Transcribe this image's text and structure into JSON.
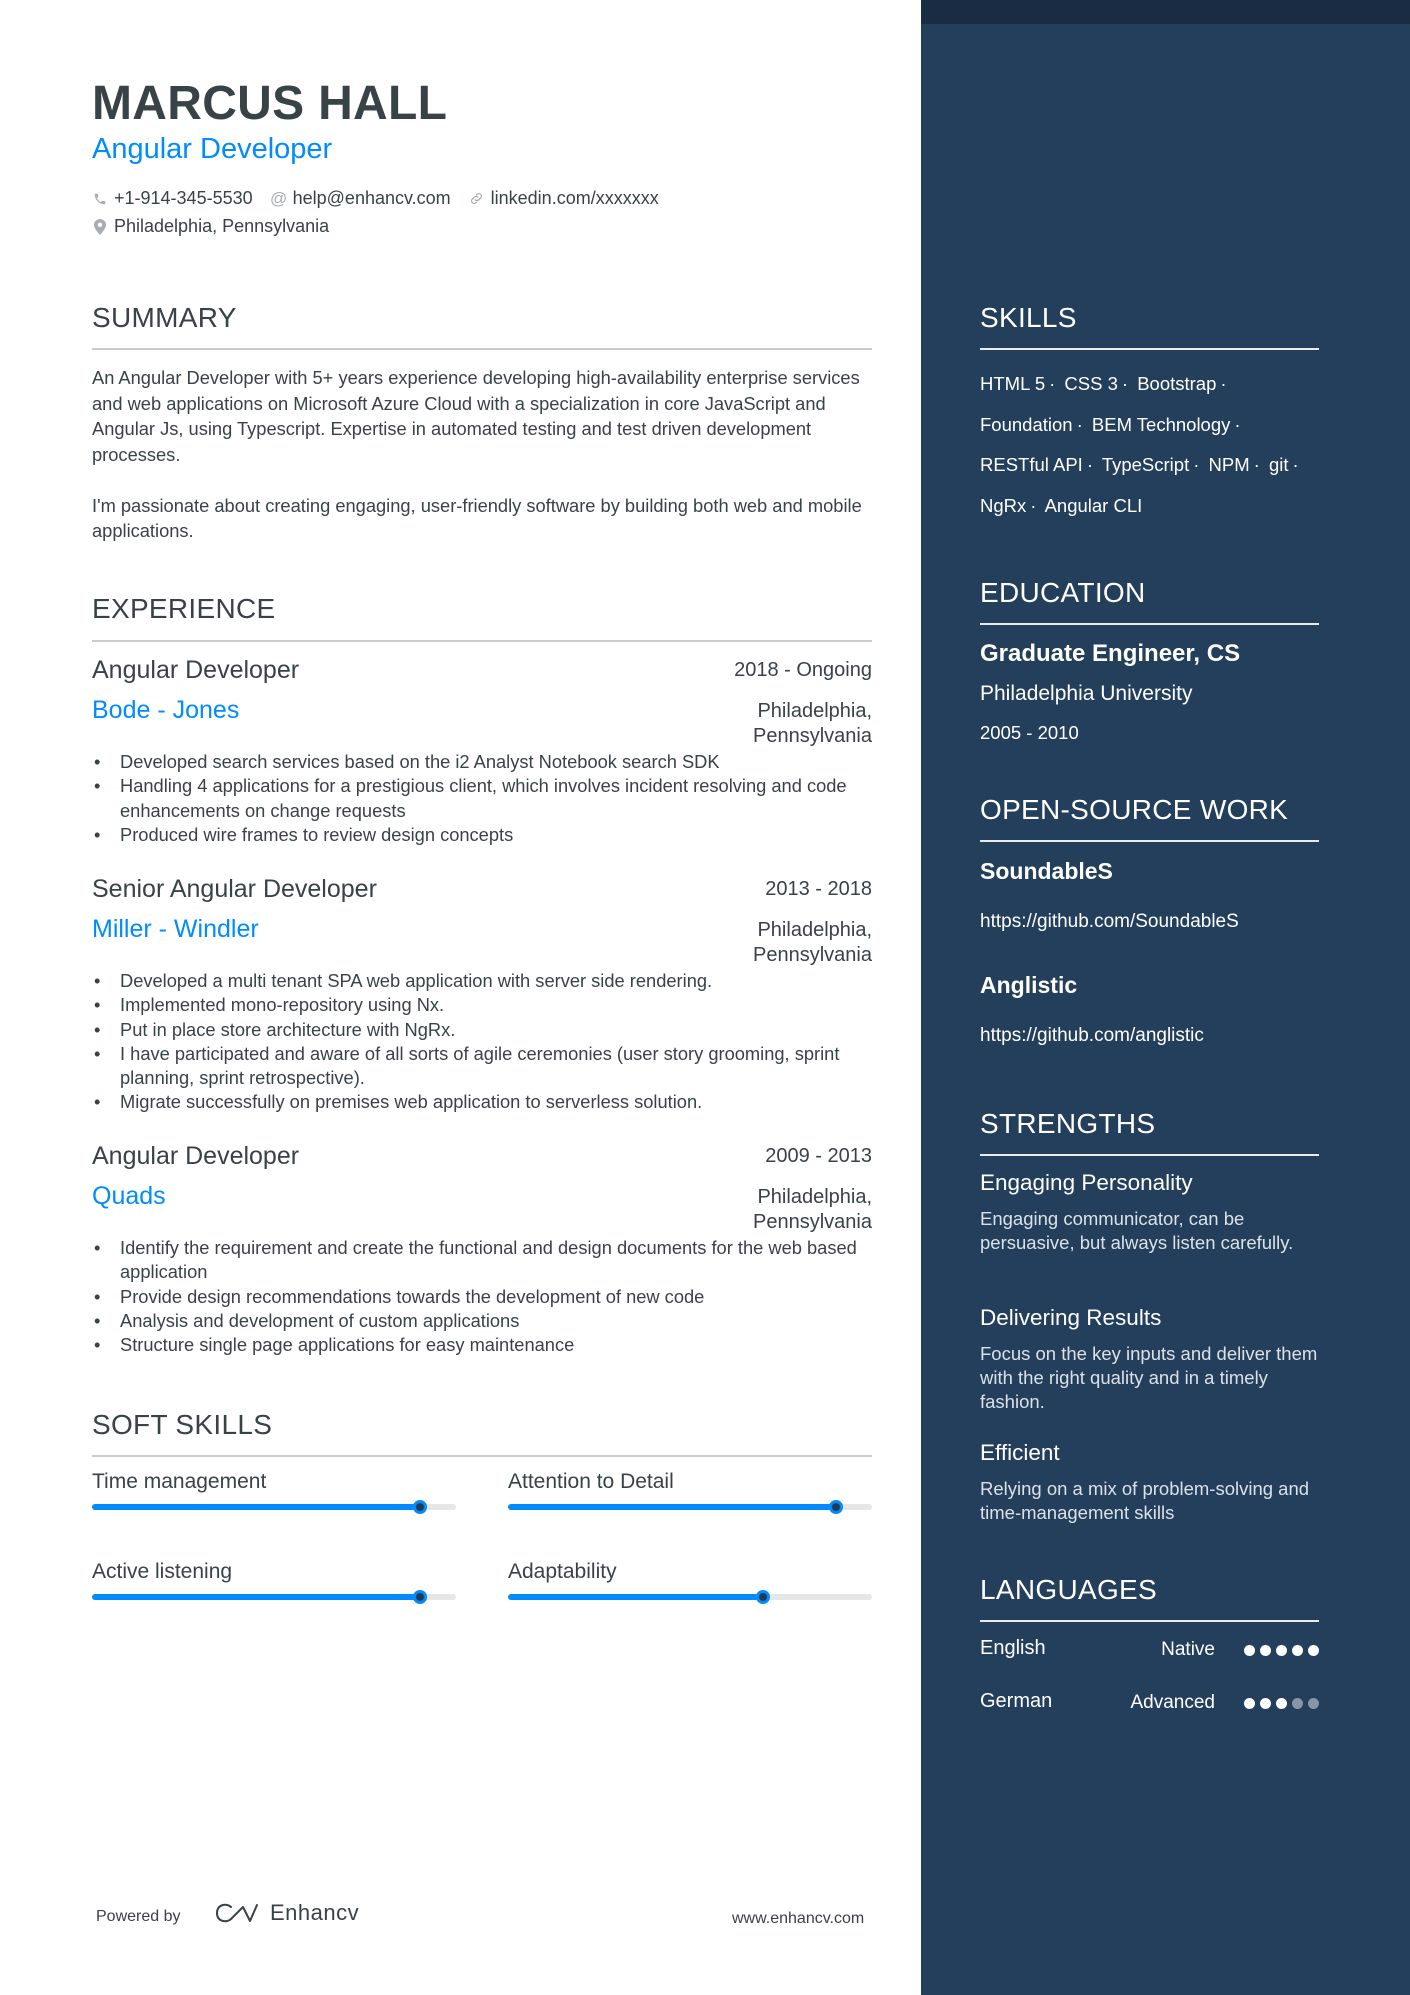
{
  "header": {
    "name": "MARCUS HALL",
    "title": "Angular Developer",
    "contacts": [
      {
        "icon": "phone-icon",
        "text": "+1-914-345-5530"
      },
      {
        "icon": "at-icon",
        "text": "help@enhancv.com"
      },
      {
        "icon": "link-icon",
        "text": "linkedin.com/xxxxxxx"
      },
      {
        "icon": "location-pin-icon",
        "text": "Philadelphia, Pennsylvania"
      }
    ]
  },
  "summary": {
    "title": "SUMMARY",
    "paragraphs": [
      "An Angular Developer with 5+ years experience developing high-availability enterprise services and web applications on Microsoft Azure Cloud with a specialization in core JavaScript and Angular Js, using Typescript. Expertise in automated testing and test driven development processes.",
      "I'm passionate about creating engaging, user-friendly software by building both web and mobile applications."
    ]
  },
  "experience": {
    "title": "EXPERIENCE",
    "jobs": [
      {
        "role": "Angular Developer",
        "dates": "2018 - Ongoing",
        "company": "Bode - Jones",
        "location": "Philadelphia, Pennsylvania",
        "bullets": [
          "Developed search services based on the i2 Analyst Notebook search SDK",
          "Handling 4 applications for a prestigious client, which involves incident resolving and code enhancements on change requests",
          "Produced wire frames to review design concepts"
        ]
      },
      {
        "role": "Senior Angular Developer",
        "dates": "2013 - 2018",
        "company": "Miller - Windler",
        "location": "Philadelphia, Pennsylvania",
        "bullets": [
          "Developed a multi tenant SPA web application with server side rendering.",
          "Implemented mono-repository using Nx.",
          "Put in place store architecture with NgRx.",
          "I have participated and aware of all sorts of agile ceremonies (user story grooming, sprint planning, sprint retrospective).",
          "Migrate successfully on premises web application to serverless solution."
        ]
      },
      {
        "role": "Angular Developer",
        "dates": "2009 - 2013",
        "company": "Quads",
        "location": "Philadelphia, Pennsylvania",
        "bullets": [
          "Identify the requirement and create the functional and design documents for the web based application",
          "Provide design recommendations towards the development of new code",
          "Analysis and development of custom applications",
          "Structure single page applications for easy maintenance"
        ]
      }
    ]
  },
  "soft_skills": {
    "title": "SOFT SKILLS",
    "items": [
      {
        "label": "Time management",
        "level": 0.9
      },
      {
        "label": "Attention to Detail",
        "level": 0.9
      },
      {
        "label": "Active listening",
        "level": 0.9
      },
      {
        "label": "Adaptability",
        "level": 0.7
      }
    ]
  },
  "footer": {
    "powered_by": "Powered by",
    "brand": "Enhancv",
    "url": "www.enhancv.com"
  },
  "sidebar": {
    "skills": {
      "title": "SKILLS",
      "items": [
        "HTML 5",
        "CSS 3",
        "Bootstrap",
        "Foundation",
        "BEM Technology",
        "RESTful API",
        "TypeScript",
        "NPM",
        "git",
        "NgRx",
        "Angular CLI"
      ]
    },
    "education": {
      "title": "EDUCATION",
      "degree": "Graduate Engineer, CS",
      "school": "Philadelphia University",
      "dates": "2005 - 2010"
    },
    "open_source": {
      "title": "OPEN-SOURCE WORK",
      "projects": [
        {
          "name": "SoundableS",
          "url": "https://github.com/SoundableS"
        },
        {
          "name": "Anglistic",
          "url": "https://github.com/anglistic"
        }
      ]
    },
    "strengths": {
      "title": "STRENGTHS",
      "items": [
        {
          "title": "Engaging Personality",
          "description": "Engaging communicator, can be persuasive, but always listen carefully."
        },
        {
          "title": "Delivering Results",
          "description": "Focus on the key inputs and deliver them with the right quality and in a timely fashion."
        },
        {
          "title": "Efficient",
          "description": "Relying on a mix of problem-solving and time-management skills"
        }
      ]
    },
    "languages": {
      "title": "LANGUAGES",
      "items": [
        {
          "name": "English",
          "level": "Native",
          "dots": 5,
          "max": 5
        },
        {
          "name": "German",
          "level": "Advanced",
          "dots": 3,
          "max": 5
        }
      ]
    }
  },
  "colors": {
    "accent": "#008cff",
    "text": "#384347",
    "sidebar_bg": "#233f5c",
    "sidebar_top": "#1a2c44"
  }
}
